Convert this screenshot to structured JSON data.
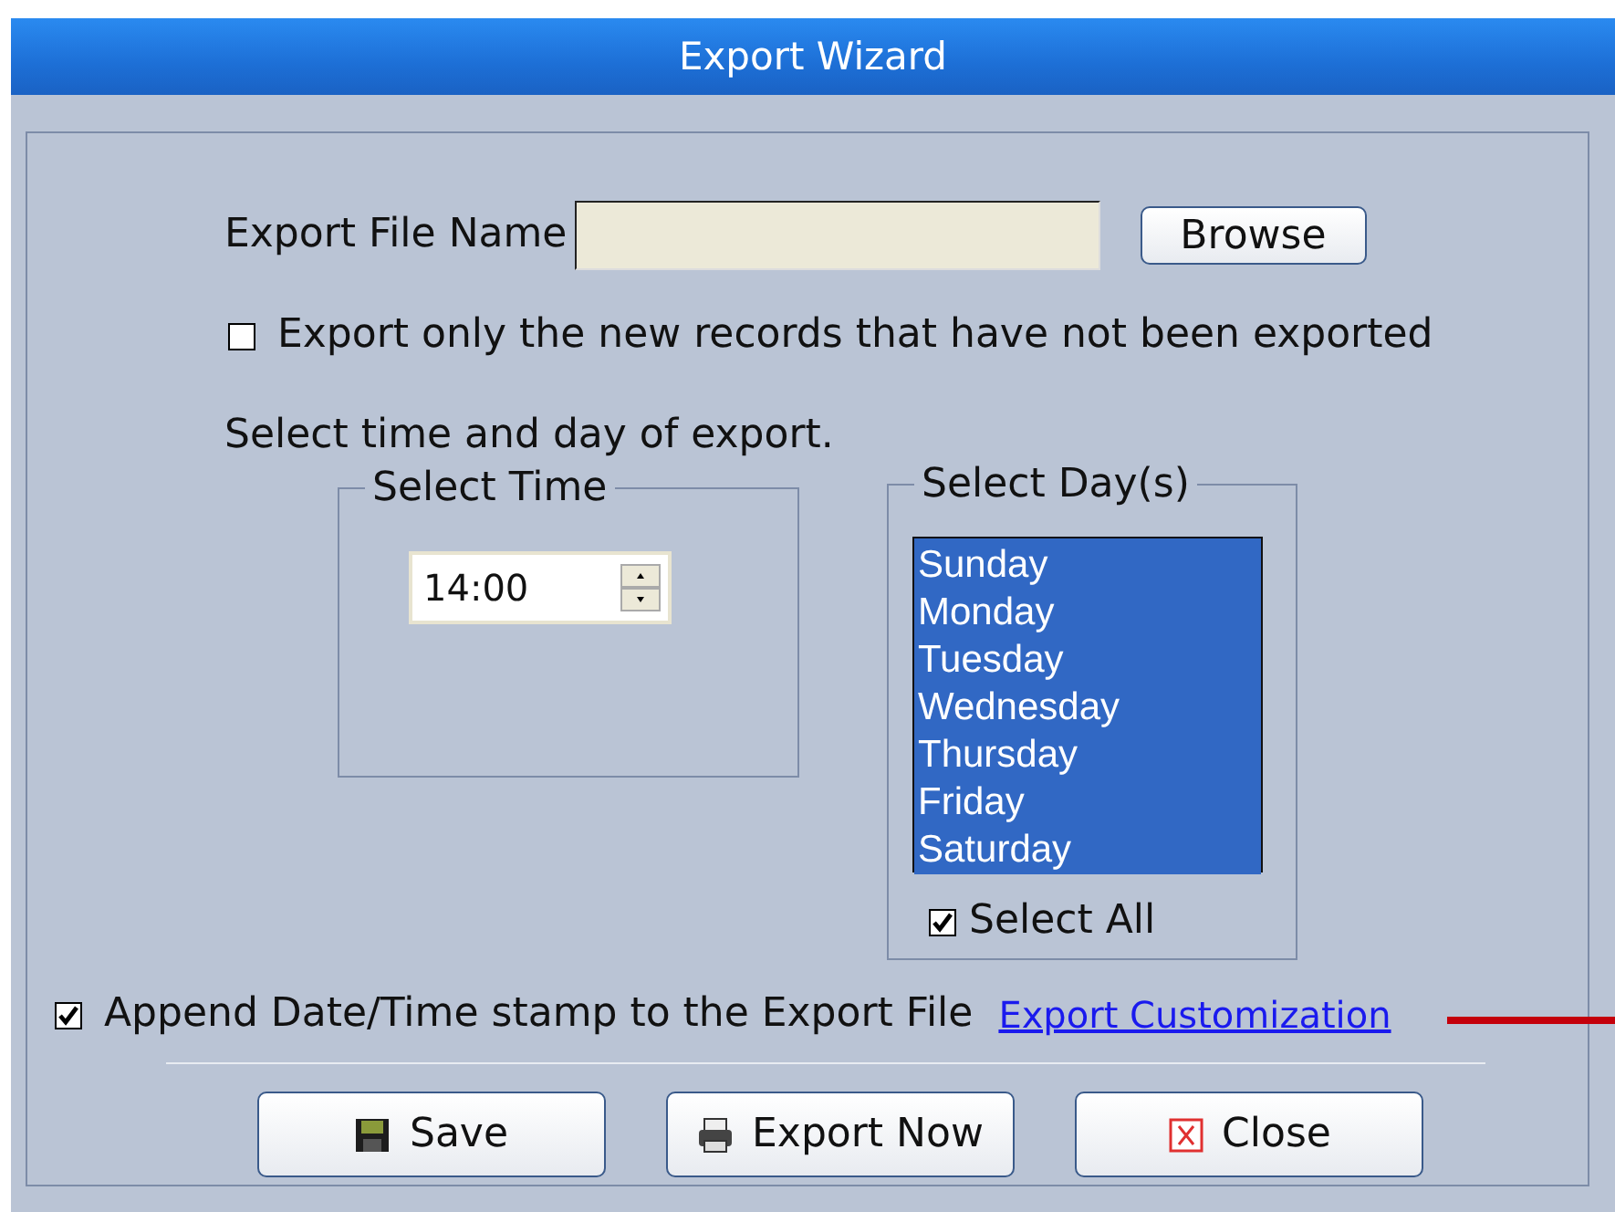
{
  "window": {
    "title": "Export Wizard"
  },
  "file": {
    "label": "Export File Name",
    "browse": "Browse"
  },
  "only_new": {
    "label": "Export only the new records that have not been exported",
    "checked": false
  },
  "schedule_label": "Select time and day of export.",
  "time_group": {
    "title": "Select Time",
    "value": "14:00"
  },
  "day_group": {
    "title": "Select Day(s)",
    "days": [
      {
        "label": "Sunday",
        "selected": true
      },
      {
        "label": "Monday",
        "selected": true
      },
      {
        "label": "Tuesday",
        "selected": true
      },
      {
        "label": "Wednesday",
        "selected": true
      },
      {
        "label": "Thursday",
        "selected": true
      },
      {
        "label": "Friday",
        "selected": true
      },
      {
        "label": "Saturday",
        "selected": true
      }
    ],
    "select_all": {
      "label": "Select All",
      "checked": true
    }
  },
  "append": {
    "label": "Append Date/Time stamp to the Export File",
    "checked": true,
    "link": "Export Customization"
  },
  "buttons": [
    {
      "kind": "save",
      "label": "Save"
    },
    {
      "kind": "print",
      "label": "Export Now"
    },
    {
      "kind": "close",
      "label": "Close"
    }
  ]
}
